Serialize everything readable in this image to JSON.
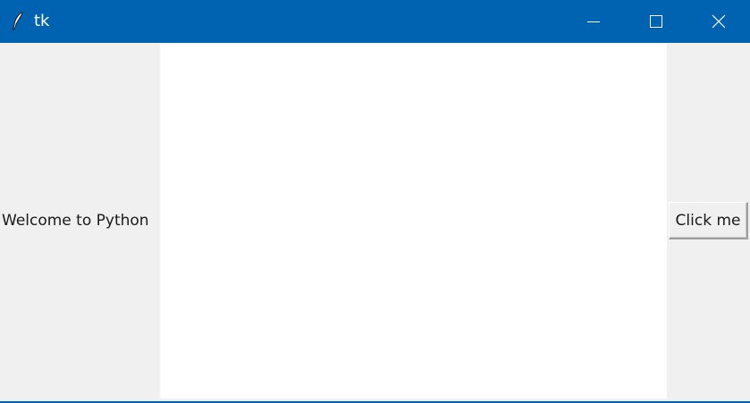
{
  "window": {
    "title": "tk",
    "icon": "feather-icon",
    "titlebar_color": "#0063b1",
    "controls": {
      "minimize": "minimize-icon",
      "maximize": "maximize-icon",
      "close": "close-icon"
    }
  },
  "content": {
    "label_text": "Welcome to Python",
    "button_label": "Click me",
    "canvas_color": "#ffffff",
    "background_color": "#f0f0f0"
  }
}
